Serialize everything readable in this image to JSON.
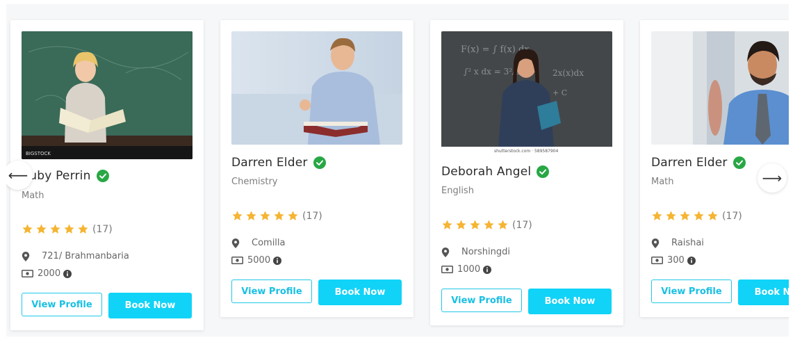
{
  "teachers": [
    {
      "name": "Ruby Perrin",
      "subject": "Math",
      "reviews": "(17)",
      "location": "721/ Brahmanbaria",
      "fee": "2000",
      "photo_watermark": "BIGSTOCK",
      "view_label": "View Profile",
      "book_label": "Book Now"
    },
    {
      "name": "Darren Elder",
      "subject": "Chemistry",
      "reviews": "(17)",
      "location": "Comilla",
      "fee": "5000",
      "view_label": "View Profile",
      "book_label": "Book Now"
    },
    {
      "name": "Deborah Angel",
      "subject": "English",
      "reviews": "(17)",
      "location": "Norshingdi",
      "fee": "1000",
      "photo_caption": "shutterstock.com · 589587904",
      "view_label": "View Profile",
      "book_label": "Book Now"
    },
    {
      "name": "Darren Elder",
      "subject": "Math",
      "reviews": "(17)",
      "location": "Raishai",
      "fee": "300",
      "view_label": "View Profile",
      "book_label": "Book Now"
    }
  ],
  "nav": {
    "prev_glyph": "⟵",
    "next_glyph": "⟶"
  },
  "colors": {
    "accent": "#10d3f7",
    "accent_border": "#1ec8e8",
    "star": "#f5b432",
    "verified": "#28a745"
  },
  "icons": {
    "verified": "verified-check-icon",
    "star": "star-icon",
    "location": "map-pin-icon",
    "fee": "money-icon",
    "info": "info-icon"
  }
}
